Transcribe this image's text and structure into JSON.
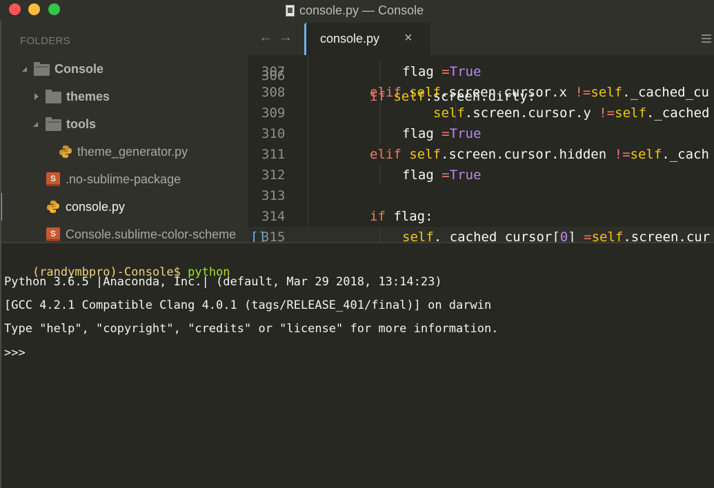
{
  "window": {
    "title": "console.py — Console",
    "traffic_lights": [
      "close",
      "minimize",
      "maximize"
    ]
  },
  "sidebar": {
    "section_label": "FOLDERS",
    "tree": [
      {
        "type": "folder",
        "label": "Console",
        "expanded": true,
        "depth": 0
      },
      {
        "type": "folder",
        "label": "themes",
        "expanded": false,
        "depth": 1
      },
      {
        "type": "folder",
        "label": "tools",
        "expanded": true,
        "depth": 1
      },
      {
        "type": "file",
        "label": "theme_generator.py",
        "icon": "python-icon",
        "depth": 2
      },
      {
        "type": "file",
        "label": ".no-sublime-package",
        "icon": "sublime-icon",
        "depth": 1
      },
      {
        "type": "file",
        "label": "console.py",
        "icon": "python-icon",
        "depth": 1,
        "active": true
      },
      {
        "type": "file",
        "label": "Console.sublime-color-scheme",
        "icon": "sublime-icon",
        "depth": 1
      }
    ]
  },
  "tabbar": {
    "back_icon": "←",
    "forward_icon": "→",
    "tabs": [
      {
        "label": "console.py",
        "active": true,
        "close_icon": "×"
      }
    ],
    "menu_icon": "hamburger-icon"
  },
  "editor": {
    "partial_top_line": "if self.screen.dirty:",
    "lines": [
      {
        "num": "307",
        "tokens": [
          [
            "",
            "        "
          ],
          [
            "",
            "flag "
          ],
          [
            "op",
            "="
          ],
          [
            "cst",
            " True"
          ]
        ]
      },
      {
        "num": "308",
        "tokens": [
          [
            "kw",
            "elif "
          ],
          [
            "sf",
            "self"
          ],
          [
            "",
            ".screen.cursor.x "
          ],
          [
            "op",
            "!="
          ],
          [
            "sf",
            " self"
          ],
          [
            "",
            "._cached_cu"
          ]
        ]
      },
      {
        "num": "309",
        "tokens": [
          [
            "",
            "        "
          ],
          [
            "sf",
            "self"
          ],
          [
            "",
            ".screen.cursor.y "
          ],
          [
            "op",
            "!="
          ],
          [
            "sf",
            " self"
          ],
          [
            "",
            "._cached"
          ]
        ]
      },
      {
        "num": "310",
        "tokens": [
          [
            "",
            "    "
          ],
          [
            "",
            "flag "
          ],
          [
            "op",
            "="
          ],
          [
            "cst",
            " True"
          ]
        ]
      },
      {
        "num": "311",
        "tokens": [
          [
            "kw",
            "elif "
          ],
          [
            "sf",
            "self"
          ],
          [
            "",
            ".screen.cursor.hidden "
          ],
          [
            "op",
            "!="
          ],
          [
            "sf",
            " self"
          ],
          [
            "",
            "._cach"
          ]
        ]
      },
      {
        "num": "312",
        "tokens": [
          [
            "",
            "    "
          ],
          [
            "",
            "flag "
          ],
          [
            "op",
            "="
          ],
          [
            "cst",
            " True"
          ]
        ]
      },
      {
        "num": "313",
        "tokens": []
      },
      {
        "num": "314",
        "tokens": [
          [
            "kw",
            "if "
          ],
          [
            "",
            "flag:"
          ]
        ]
      },
      {
        "num": "315",
        "tokens": [
          [
            "",
            "    "
          ],
          [
            "sf",
            "self"
          ],
          [
            "",
            "._cached_cursor["
          ],
          [
            "cst",
            "0"
          ],
          [
            "",
            "] "
          ],
          [
            "op",
            "="
          ],
          [
            "sf",
            " self"
          ],
          [
            "",
            ".screen.cur"
          ]
        ]
      }
    ],
    "fold_marker": "[]"
  },
  "console": {
    "prompt_user": "(randymbpro)-Console$ ",
    "prompt_command": "python",
    "output": [
      "Python 3.6.5 |Anaconda, Inc.| (default, Mar 29 2018, 13:14:23)",
      "[GCC 4.2.1 Compatible Clang 4.0.1 (tags/RELEASE_401/final)] on darwin",
      "Type \"help\", \"copyright\", \"credits\" or \"license\" for more information."
    ],
    "repl_prompt": ">>>"
  },
  "colors": {
    "accent": "#6fb2e6",
    "keyword": "#f47a6a",
    "self": "#f5c518",
    "constant": "#b889f4",
    "background": "#272822",
    "chrome": "#31312c"
  }
}
